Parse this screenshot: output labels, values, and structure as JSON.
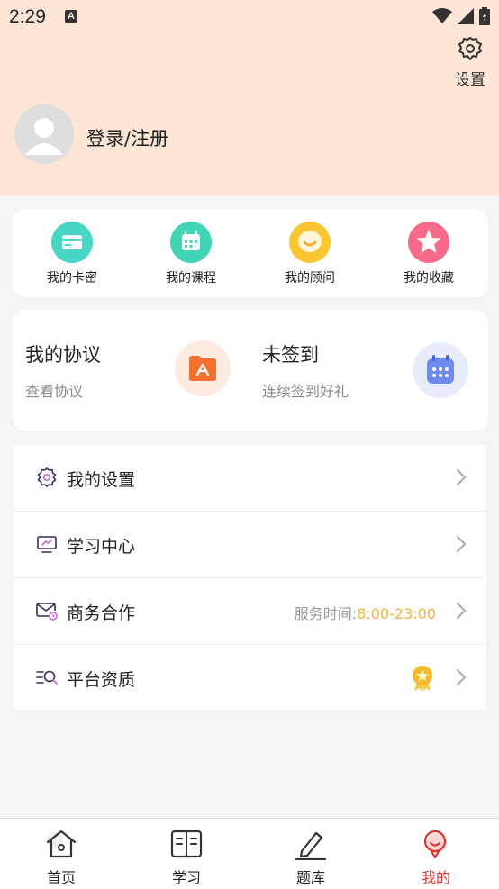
{
  "status_bar": {
    "time": "2:29",
    "notification_glyph": "A"
  },
  "header": {
    "settings_label": "设置",
    "login_label": "登录/注册",
    "background": "#fde6d6"
  },
  "quick_actions": [
    {
      "label": "我的卡密",
      "icon": "card-icon",
      "color": "#48d6c4"
    },
    {
      "label": "我的课程",
      "icon": "calendar-icon",
      "color": "#3fd5b5"
    },
    {
      "label": "我的顾问",
      "icon": "chat-bubble-icon",
      "color": "#f9c631"
    },
    {
      "label": "我的收藏",
      "icon": "star-icon",
      "color": "#f76b8a"
    }
  ],
  "promo": {
    "agreement_title": "我的协议",
    "agreement_sub": "查看协议",
    "checkin_title": "未签到",
    "checkin_sub": "连续签到好礼"
  },
  "menu": {
    "settings_label": "我的设置",
    "study_center_label": "学习中心",
    "business_label": "商务合作",
    "business_hours_prefix": "服务时间:",
    "business_hours": "8:00-23:00",
    "qualification_label": "平台资质"
  },
  "tabs": [
    {
      "label": "首页",
      "icon": "home-icon",
      "active": false
    },
    {
      "label": "学习",
      "icon": "book-icon",
      "active": false
    },
    {
      "label": "题库",
      "icon": "pencil-icon",
      "active": false
    },
    {
      "label": "我的",
      "icon": "profile-icon",
      "active": true
    }
  ],
  "colors": {
    "accent": "#e0302e",
    "hours": "#f0b43a"
  }
}
